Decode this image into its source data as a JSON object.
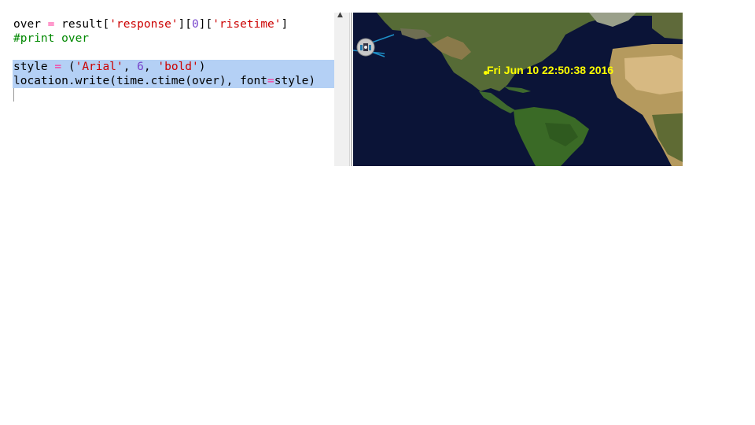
{
  "editor": {
    "line1_var": "over",
    "line1_op": " = ",
    "line1_call": "result[",
    "line1_str1": "'response'",
    "line1_mid1": "][",
    "line1_num": "0",
    "line1_mid2": "][",
    "line1_str2": "'risetime'",
    "line1_end": "]",
    "line2_comment": "#print over",
    "line3_var": "style",
    "line3_op": " = ",
    "line3_open": "(",
    "line3_str1": "'Arial'",
    "line3_sep1": ", ",
    "line3_num": "6",
    "line3_sep2": ", ",
    "line3_str2": "'bold'",
    "line3_close": ")",
    "line4_start": "location.write(time.ctime(over), font",
    "line4_op": "=",
    "line4_end": "style)"
  },
  "scrollbar": {
    "up_arrow": "▲"
  },
  "map": {
    "time_text": "Fri Jun 10 22:50:38 2016",
    "label_color": "#ffff00",
    "ocean_color": "#0b1437",
    "iss_icon": "satellite-icon"
  }
}
